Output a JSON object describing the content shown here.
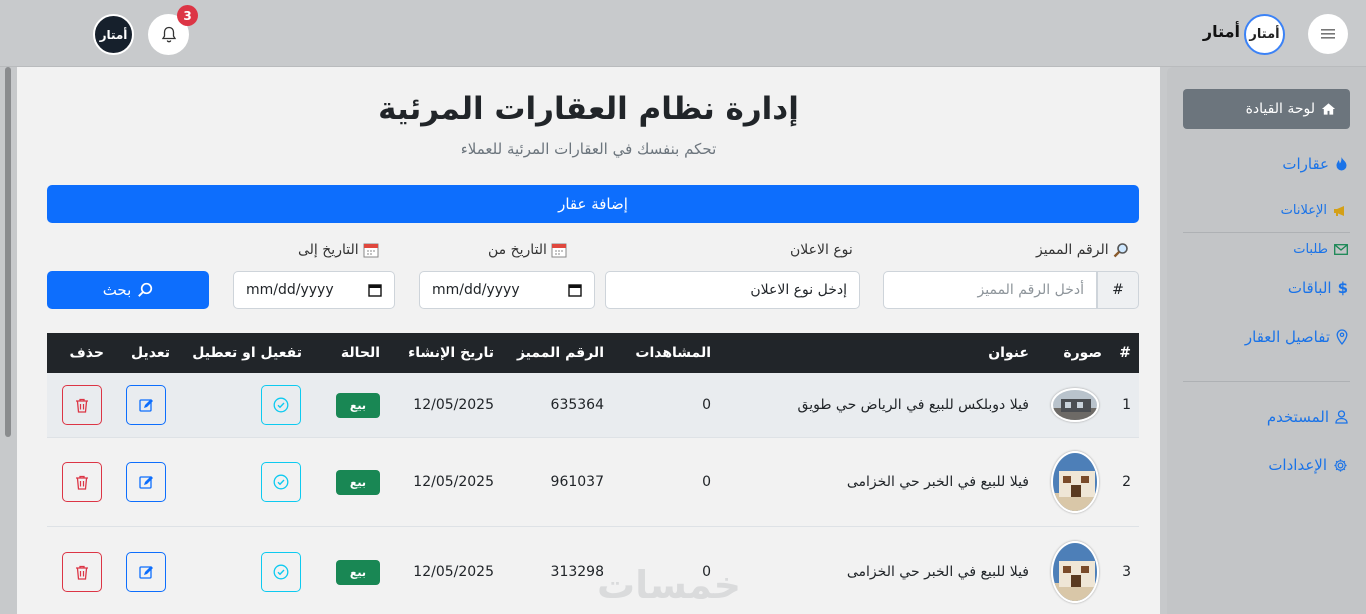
{
  "topbar": {
    "brand_name": "أمتار",
    "brand_logo_text": "أمتار",
    "avatar_text": "أمتار",
    "notification_count": "3"
  },
  "sidebar": {
    "active_item": "لوحة القيادة",
    "items": [
      {
        "label": "عقارات",
        "icon": "fire-icon"
      },
      {
        "label": "الإعلانات",
        "icon": "megaphone-icon"
      },
      {
        "label": "طلبات",
        "icon": "envelope-icon"
      },
      {
        "label": "الباقات",
        "icon": "dollar-icon"
      },
      {
        "label": "تفاصيل العقار",
        "icon": "map-pin-icon"
      },
      {
        "label": "المستخدم",
        "icon": "user-icon"
      },
      {
        "label": "الإعدادات",
        "icon": "gear-icon"
      }
    ]
  },
  "main": {
    "title": "إدارة نظام العقارات المرئية",
    "subtitle": "تحكم بنفسك في العقارات المرئية للعملاء",
    "add_button": "إضافة عقار"
  },
  "filters": {
    "code_label": "الرقم المميز",
    "code_placeholder": "أدخل الرقم المميز",
    "code_prefix": "#",
    "ad_type_label": "نوع الاعلان",
    "ad_type_placeholder": "إدخل نوع الاعلان",
    "date_from_label": "التاريخ من",
    "date_from_value": "mm/dd/yyyy",
    "date_to_label": "التاريخ إلى",
    "date_to_value": "mm/dd/yyyy",
    "search_button": "بحث"
  },
  "table": {
    "headers": {
      "index": "#",
      "image": "صورة",
      "title": "عنوان",
      "views": "المشاهدات",
      "code": "الرقم المميز",
      "created": "تاريخ الإنشاء",
      "status": "الحالة",
      "toggle": "تفعيل او تعطيل",
      "edit": "تعديل",
      "delete": "حذف"
    },
    "rows": [
      {
        "index": "1",
        "title": "فيلا دوبلكس للبيع في الرياض حي طويق",
        "views": "0",
        "code": "635364",
        "created": "12/05/2025",
        "status": "بيع"
      },
      {
        "index": "2",
        "title": "فيلا للبيع في الخبر حي الخزامى",
        "views": "0",
        "code": "961037",
        "created": "12/05/2025",
        "status": "بيع"
      },
      {
        "index": "3",
        "title": "فيلا للبيع في الخبر حي الخزامى",
        "views": "0",
        "code": "313298",
        "created": "12/05/2025",
        "status": "بيع"
      }
    ]
  },
  "watermark": "خمسات",
  "colors": {
    "primary": "#0d6efd",
    "success": "#198754",
    "danger": "#dc3545",
    "info": "#0dcaf0",
    "table_header": "#212529",
    "notification_badge": "#dc3545"
  }
}
